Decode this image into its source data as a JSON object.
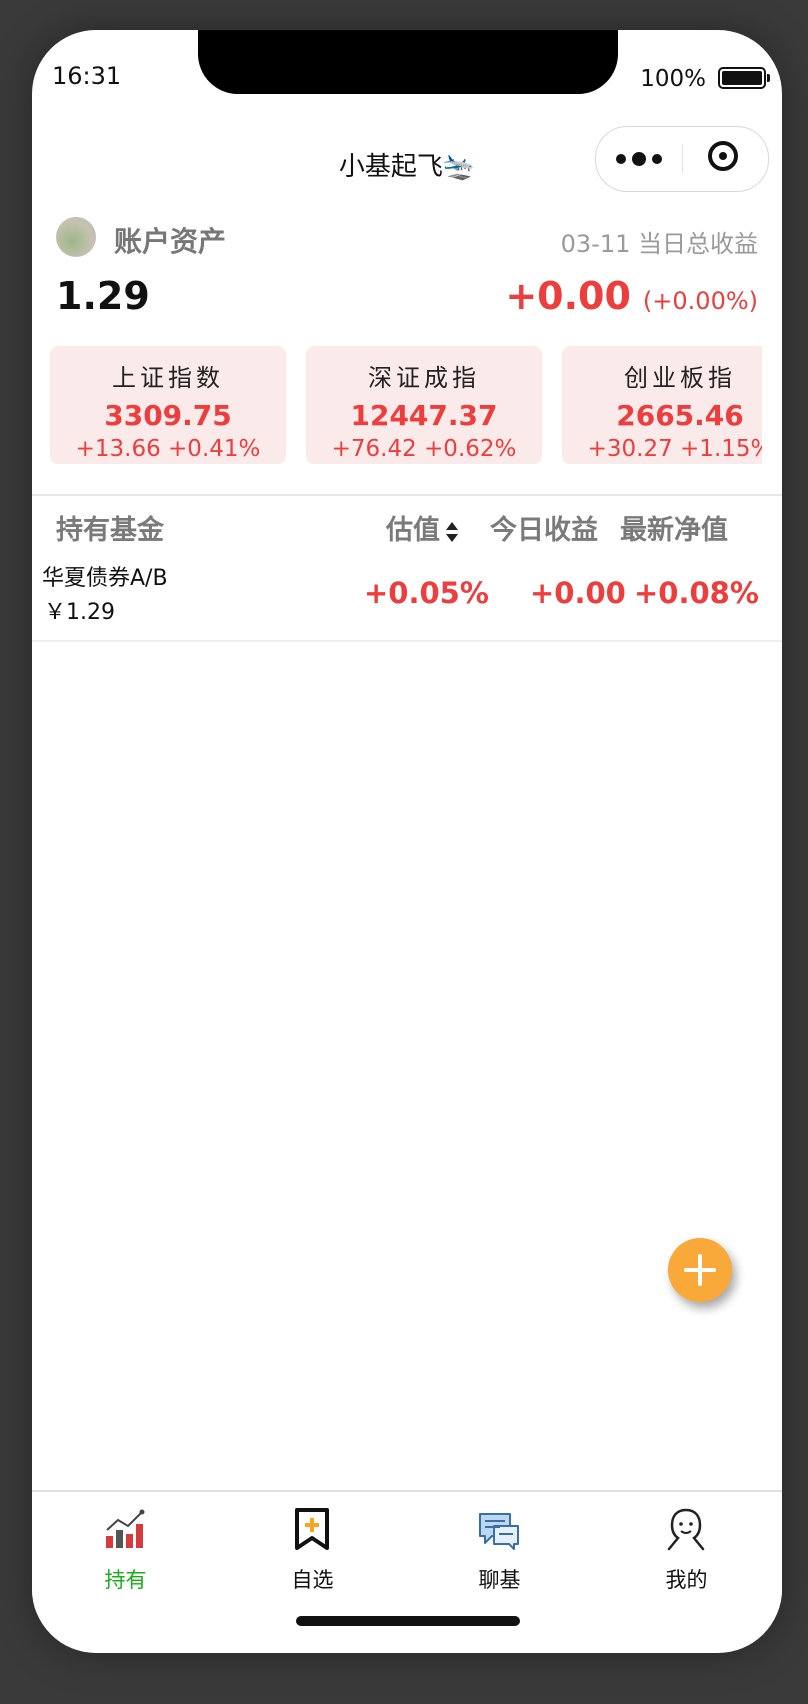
{
  "status_bar": {
    "time": "16:31",
    "battery": "100%"
  },
  "nav": {
    "title": "小基起飞🛬"
  },
  "account": {
    "label": "账户资产",
    "date_label": "03-11 当日总收益",
    "total_assets": "1.29",
    "day_profit": "+0.00",
    "day_profit_pct": "(+0.00%)"
  },
  "indices": [
    {
      "name": "上证指数",
      "price": "3309.75",
      "change": "+13.66 +0.41%"
    },
    {
      "name": "深证成指",
      "price": "12447.37",
      "change": "+76.42 +0.62%"
    },
    {
      "name": "创业板指",
      "price": "2665.46",
      "change": "+30.27 +1.15%"
    }
  ],
  "table": {
    "headers": {
      "fund": "持有基金",
      "estimate": "估值",
      "today_profit": "今日收益",
      "latest_nav": "最新净值"
    },
    "rows": [
      {
        "name": "华夏债券A/B",
        "amount": "￥1.29",
        "estimate": "+0.05%",
        "today_profit": "+0.00",
        "latest_nav": "+0.08%"
      }
    ]
  },
  "tabbar": [
    {
      "label": "持有",
      "icon": "chart-icon",
      "active": true
    },
    {
      "label": "自选",
      "icon": "bookmark-add-icon",
      "active": false
    },
    {
      "label": "聊基",
      "icon": "chat-icon",
      "active": false
    },
    {
      "label": "我的",
      "icon": "user-icon",
      "active": false
    }
  ],
  "colors": {
    "up": "#ee3d3d",
    "active_tab": "#1aad19",
    "fab": "#f9a83a",
    "index_card_bg": "#fbeaea"
  }
}
